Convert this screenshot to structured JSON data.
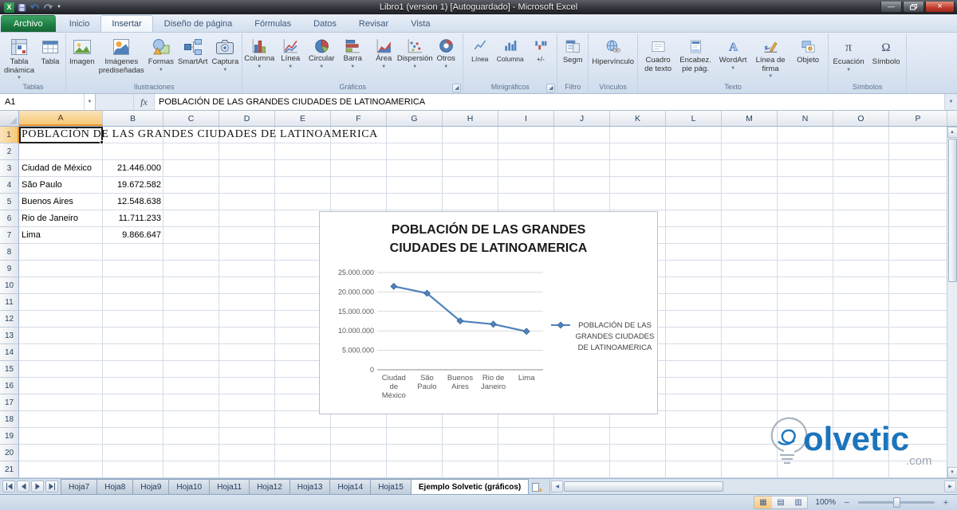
{
  "window": {
    "title": "Libro1 (version 1) [Autoguardado] - Microsoft Excel"
  },
  "ribbon": {
    "tabs": [
      {
        "label": "Archivo",
        "type": "file"
      },
      {
        "label": "Inicio"
      },
      {
        "label": "Insertar",
        "active": true
      },
      {
        "label": "Diseño de página"
      },
      {
        "label": "Fórmulas"
      },
      {
        "label": "Datos"
      },
      {
        "label": "Revisar"
      },
      {
        "label": "Vista"
      }
    ],
    "groups": [
      {
        "label": "Tablas",
        "buttons": [
          {
            "label": "Tabla\ndinámica",
            "icon": "pivot-table-icon",
            "arrow": true
          },
          {
            "label": "Tabla",
            "icon": "table-icon"
          }
        ]
      },
      {
        "label": "Ilustraciones",
        "buttons": [
          {
            "label": "Imagen",
            "icon": "picture-icon"
          },
          {
            "label": "Imágenes\nprediseñadas",
            "icon": "clipart-icon"
          },
          {
            "label": "Formas",
            "icon": "shapes-icon",
            "arrow": true
          },
          {
            "label": "SmartArt",
            "icon": "smartart-icon"
          },
          {
            "label": "Captura",
            "icon": "screenshot-icon",
            "arrow": true
          }
        ]
      },
      {
        "label": "Gráficos",
        "launcher": true,
        "buttons": [
          {
            "label": "Columna",
            "icon": "column-chart-icon",
            "arrow": true
          },
          {
            "label": "Línea",
            "icon": "line-chart-icon",
            "arrow": true
          },
          {
            "label": "Circular",
            "icon": "pie-chart-icon",
            "arrow": true
          },
          {
            "label": "Barra",
            "icon": "bar-chart-icon",
            "arrow": true
          },
          {
            "label": "Área",
            "icon": "area-chart-icon",
            "arrow": true
          },
          {
            "label": "Dispersión",
            "icon": "scatter-chart-icon",
            "arrow": true
          },
          {
            "label": "Otros",
            "icon": "other-charts-icon",
            "arrow": true
          }
        ]
      },
      {
        "label": "Minigráficos",
        "launcher": true,
        "buttons": [
          {
            "label": "Línea",
            "icon": "sparkline-line-icon"
          },
          {
            "label": "Columna",
            "icon": "sparkline-column-icon"
          },
          {
            "label": "+/-",
            "icon": "sparkline-winloss-icon"
          }
        ]
      },
      {
        "label": "Filtro",
        "buttons": [
          {
            "label": "Segm",
            "icon": "slicer-icon"
          }
        ]
      },
      {
        "label": "Vínculos",
        "buttons": [
          {
            "label": "Hipervínculo",
            "icon": "hyperlink-icon"
          }
        ]
      },
      {
        "label": "Texto",
        "buttons": [
          {
            "label": "Cuadro\nde texto",
            "icon": "textbox-icon"
          },
          {
            "label": "Encabez.\npie pág.",
            "icon": "header-footer-icon"
          },
          {
            "label": "WordArt",
            "icon": "wordart-icon",
            "arrow": true
          },
          {
            "label": "Línea de\nfirma",
            "icon": "signature-line-icon",
            "arrow": true
          },
          {
            "label": "Objeto",
            "icon": "object-icon"
          }
        ]
      },
      {
        "label": "Símbolos",
        "buttons": [
          {
            "label": "Ecuación",
            "icon": "equation-icon",
            "arrow": true
          },
          {
            "label": "Símbolo",
            "icon": "symbol-icon"
          }
        ]
      }
    ]
  },
  "formula_bar": {
    "name_box": "A1",
    "fx_label": "fx",
    "content": "POBLACIÓN DE LAS GRANDES CIUDADES DE LATINOAMERICA"
  },
  "grid": {
    "column_headers": [
      "A",
      "B",
      "C",
      "D",
      "E",
      "F",
      "G",
      "H",
      "I",
      "J",
      "K",
      "L",
      "M",
      "N",
      "O",
      "P"
    ],
    "visible_rows": 21,
    "selected_cell": "A1",
    "cells": [
      {
        "ref": "A1",
        "row": 1,
        "col": "A",
        "value": "POBLACIÓN DE LAS GRANDES CIUDADES DE LATINOAMERICA",
        "style": "title"
      },
      {
        "ref": "A3",
        "row": 3,
        "col": "A",
        "value": "Ciudad de México"
      },
      {
        "ref": "B3",
        "row": 3,
        "col": "B",
        "value": "21.446.000",
        "align": "right"
      },
      {
        "ref": "A4",
        "row": 4,
        "col": "A",
        "value": "São Paulo"
      },
      {
        "ref": "B4",
        "row": 4,
        "col": "B",
        "value": "19.672.582",
        "align": "right"
      },
      {
        "ref": "A5",
        "row": 5,
        "col": "A",
        "value": "Buenos Aires"
      },
      {
        "ref": "B5",
        "row": 5,
        "col": "B",
        "value": "12.548.638",
        "align": "right"
      },
      {
        "ref": "A6",
        "row": 6,
        "col": "A",
        "value": "Rio de Janeiro"
      },
      {
        "ref": "B6",
        "row": 6,
        "col": "B",
        "value": "11.711.233",
        "align": "right"
      },
      {
        "ref": "A7",
        "row": 7,
        "col": "A",
        "value": "Lima"
      },
      {
        "ref": "B7",
        "row": 7,
        "col": "B",
        "value": "9.866.647",
        "align": "right"
      }
    ]
  },
  "chart_data": {
    "type": "line",
    "title": "POBLACIÓN DE LAS GRANDES CIUDADES DE LATINOAMERICA",
    "title_lines": [
      "POBLACIÓN DE LAS GRANDES",
      "CIUDADES DE LATINOAMERICA"
    ],
    "categories": [
      "Ciudad de México",
      "São Paulo",
      "Buenos Aires",
      "Rio de Janeiro",
      "Lima"
    ],
    "category_label_lines": [
      [
        "Ciudad",
        "de",
        "México"
      ],
      [
        "São",
        "Paulo"
      ],
      [
        "Buenos",
        "Aires"
      ],
      [
        "Rio de",
        "Janeiro"
      ],
      [
        "Lima"
      ]
    ],
    "series": [
      {
        "name": "POBLACIÓN DE LAS GRANDES CIUDADES DE LATINOAMERICA",
        "values": [
          21446000,
          19672582,
          12548638,
          11711233,
          9866647
        ]
      }
    ],
    "ylim": [
      0,
      25000000
    ],
    "y_tick_interval": 5000000,
    "y_tick_labels": [
      "0",
      "5.000.000",
      "10.000.000",
      "15.000.000",
      "20.000.000",
      "25.000.000"
    ],
    "legend_lines": [
      "POBLACIÓN DE LAS",
      "GRANDES CIUDADES",
      "DE LATINOAMERICA"
    ],
    "legend_position": "right",
    "grid": true,
    "line_color": "#4f81bd",
    "marker": "diamond"
  },
  "logo": {
    "text": "olvetic",
    "suffix": ".com"
  },
  "sheet_tabs": {
    "tabs": [
      {
        "label": "Hoja7"
      },
      {
        "label": "Hoja8"
      },
      {
        "label": "Hoja9"
      },
      {
        "label": "Hoja10"
      },
      {
        "label": "Hoja11"
      },
      {
        "label": "Hoja12"
      },
      {
        "label": "Hoja13"
      },
      {
        "label": "Hoja14"
      },
      {
        "label": "Hoja15"
      },
      {
        "label": "Ejemplo Solvetic (gráficos)",
        "active": true
      }
    ]
  },
  "status_bar": {
    "zoom": "100%"
  }
}
